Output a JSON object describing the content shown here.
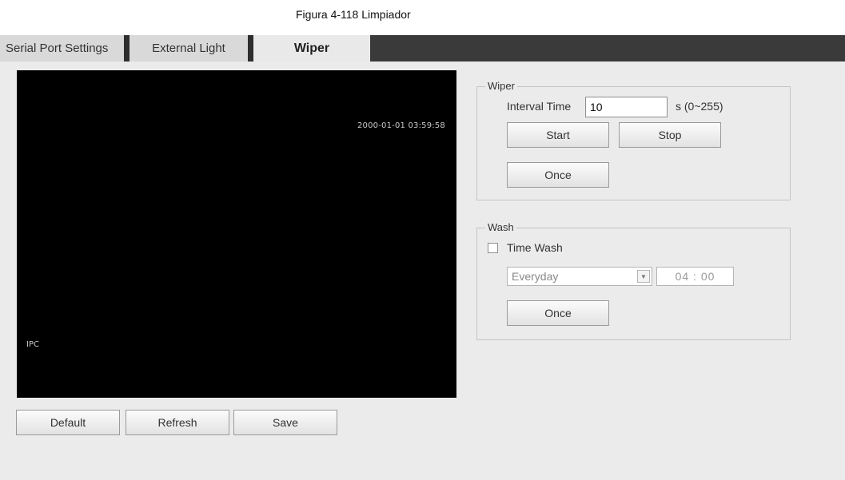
{
  "caption": "Figura 4-118 Limpiador",
  "tabs": {
    "serial": "Serial Port Settings",
    "external": "External Light",
    "wiper": "Wiper"
  },
  "video": {
    "timestamp": "2000-01-01 03:59:58",
    "channel": "IPC"
  },
  "wiper": {
    "legend": "Wiper",
    "interval_label": "Interval Time",
    "interval_value": "10",
    "interval_unit": "s (0~255)",
    "start": "Start",
    "stop": "Stop",
    "once": "Once"
  },
  "wash": {
    "legend": "Wash",
    "time_wash_label": "Time Wash",
    "time_wash_checked": false,
    "schedule": "Everyday",
    "time": "04 : 00",
    "once": "Once"
  },
  "footer": {
    "default": "Default",
    "refresh": "Refresh",
    "save": "Save"
  },
  "icons": {
    "dropdown": "chevron-down-icon"
  }
}
